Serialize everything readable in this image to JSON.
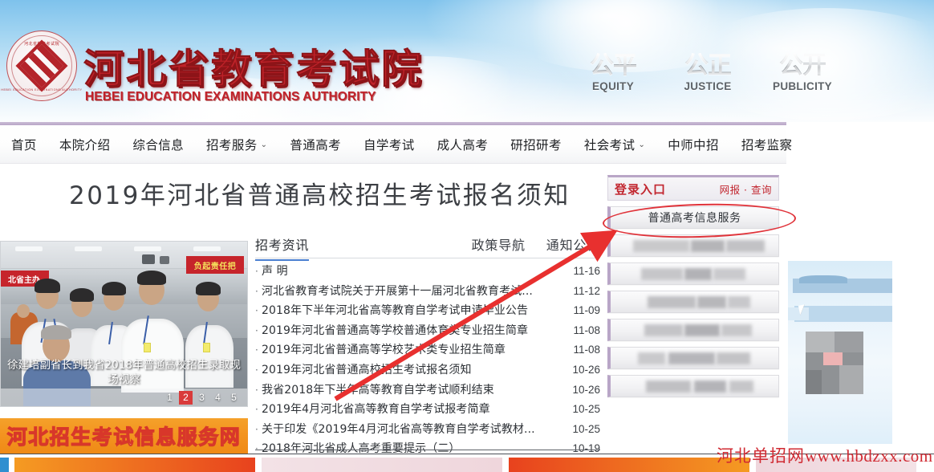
{
  "header": {
    "org_name_cn": "河北省教育考试院",
    "org_name_en": "HEBEI EDUCATION EXAMINATIONS AUTHORITY",
    "seal_top_text": "河北省教育考试院",
    "seal_bottom_text": "HEBEI EDUCATION EXAMINATIONS AUTHORITY",
    "values": [
      {
        "cn": "公平",
        "en": "EQUITY"
      },
      {
        "cn": "公正",
        "en": "JUSTICE"
      },
      {
        "cn": "公开",
        "en": "PUBLICITY"
      }
    ]
  },
  "nav": {
    "items": [
      {
        "label": "首页",
        "has_dropdown": false
      },
      {
        "label": "本院介绍",
        "has_dropdown": false
      },
      {
        "label": "综合信息",
        "has_dropdown": false
      },
      {
        "label": "招考服务",
        "has_dropdown": true
      },
      {
        "label": "普通高考",
        "has_dropdown": false
      },
      {
        "label": "自学考试",
        "has_dropdown": false
      },
      {
        "label": "成人高考",
        "has_dropdown": false
      },
      {
        "label": "研招研考",
        "has_dropdown": false
      },
      {
        "label": "社会考试",
        "has_dropdown": true
      },
      {
        "label": "中师中招",
        "has_dropdown": false
      },
      {
        "label": "招考监察",
        "has_dropdown": false
      }
    ],
    "chevron_icon": "chevron-down-icon"
  },
  "main": {
    "page_title": "2019年河北省普通高校招生考试报名须知"
  },
  "carousel": {
    "caption": "徐建培副省长到我省2018年普通高校招生录取现场视察",
    "photo_banner_right": "负起责任把",
    "photo_banner_left": "北省主办",
    "pages": [
      "1",
      "2",
      "3",
      "4",
      "5"
    ],
    "active_page": "2"
  },
  "orange_banner": {
    "label": "河北招生考试信息服务网"
  },
  "news": {
    "tabs": [
      {
        "label": "招考资讯",
        "active": true
      },
      {
        "label": "政策导航",
        "active": false
      },
      {
        "label": "通知公告",
        "active": false
      }
    ],
    "items": [
      {
        "title": "声 明",
        "date": "11-16"
      },
      {
        "title": "河北省教育考试院关于开展第十一届河北省教育考试...",
        "date": "11-12"
      },
      {
        "title": "2018年下半年河北省高等教育自学考试申请毕业公告",
        "date": "11-09"
      },
      {
        "title": "2019年河北省普通高等学校普通体育类专业招生简章",
        "date": "11-08"
      },
      {
        "title": "2019年河北省普通高等学校艺术类专业招生简章",
        "date": "11-08"
      },
      {
        "title": "2019年河北省普通高校招生考试报名须知",
        "date": "10-26"
      },
      {
        "title": "我省2018年下半年高等教育自学考试顺利结束",
        "date": "10-26"
      },
      {
        "title": "2019年4月河北省高等教育自学考试报考简章",
        "date": "10-25"
      },
      {
        "title": "关于印发《2019年4月河北省高等教育自学考试教材...",
        "date": "10-25"
      },
      {
        "title": "2018年河北省成人高考重要提示（二）",
        "date": "10-19"
      }
    ]
  },
  "sidebar": {
    "title": "登录入口",
    "subtitle": "网报 · 查询",
    "buttons": [
      {
        "label": "普通高考信息服务",
        "blurred": false
      },
      {
        "label": "",
        "blurred": true
      },
      {
        "label": "",
        "blurred": true
      },
      {
        "label": "",
        "blurred": true
      },
      {
        "label": "",
        "blurred": true
      },
      {
        "label": "",
        "blurred": true
      },
      {
        "label": "",
        "blurred": true
      }
    ]
  },
  "annotations": {
    "ellipse_color": "#e0333a",
    "arrow_color": "#e8302f",
    "arrow_from": "455,495",
    "arrow_to": "748,300"
  },
  "watermark": {
    "cn": "河北单招网",
    "url": "www.hbdzxx.com"
  }
}
